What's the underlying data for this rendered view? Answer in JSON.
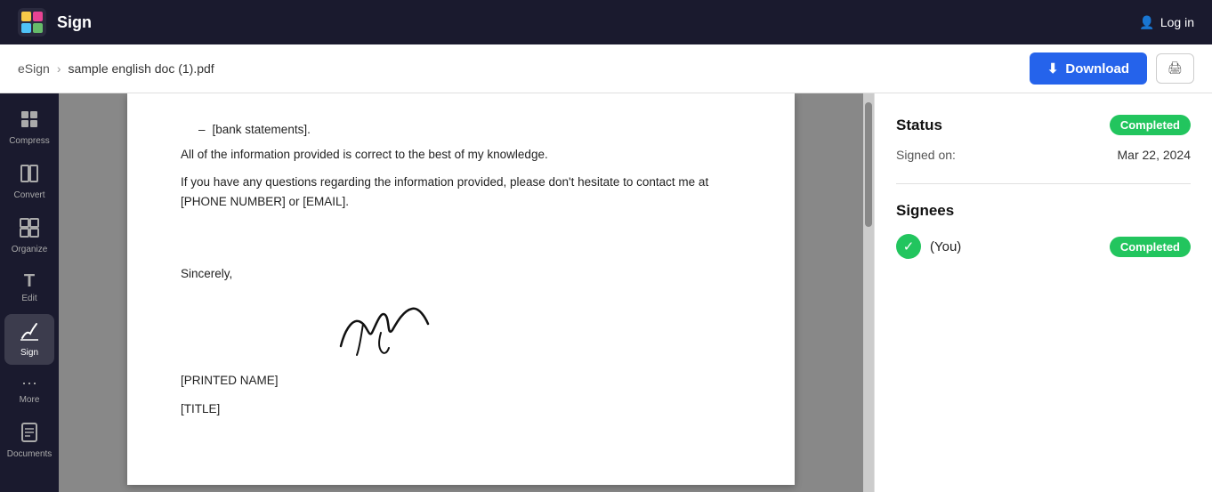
{
  "app": {
    "title": "Sign"
  },
  "topbar": {
    "login_label": "Log in"
  },
  "breadcrumb": {
    "parent": "eSign",
    "separator": "›",
    "current": "sample english doc (1).pdf"
  },
  "toolbar": {
    "download_label": "Download",
    "print_label": "🖨"
  },
  "sidebar": {
    "items": [
      {
        "id": "compress",
        "label": "Compress",
        "icon": "⬛"
      },
      {
        "id": "convert",
        "label": "Convert",
        "icon": "⬜"
      },
      {
        "id": "organize",
        "label": "Organize",
        "icon": "⊞"
      },
      {
        "id": "edit",
        "label": "Edit",
        "icon": "T"
      },
      {
        "id": "sign",
        "label": "Sign",
        "icon": "✍",
        "active": true
      },
      {
        "id": "more",
        "label": "More",
        "icon": "⋯"
      },
      {
        "id": "documents",
        "label": "Documents",
        "icon": "📄"
      }
    ]
  },
  "document": {
    "bullet": "[bank statements].",
    "para1": "All of the information provided is correct to the best of my knowledge.",
    "para2": "If you have any questions regarding the information provided, please don't hesitate to contact me at [PHONE NUMBER] or [EMAIL].",
    "sincerely": "Sincerely,",
    "printed_name": "[PRINTED NAME]",
    "title": "[TITLE]"
  },
  "right_panel": {
    "status_label": "Status",
    "status_badge": "Completed",
    "signed_on_label": "Signed on:",
    "signed_on_date": "Mar 22, 2024",
    "signees_label": "Signees",
    "signee_name": "(You)",
    "signee_badge": "Completed"
  }
}
